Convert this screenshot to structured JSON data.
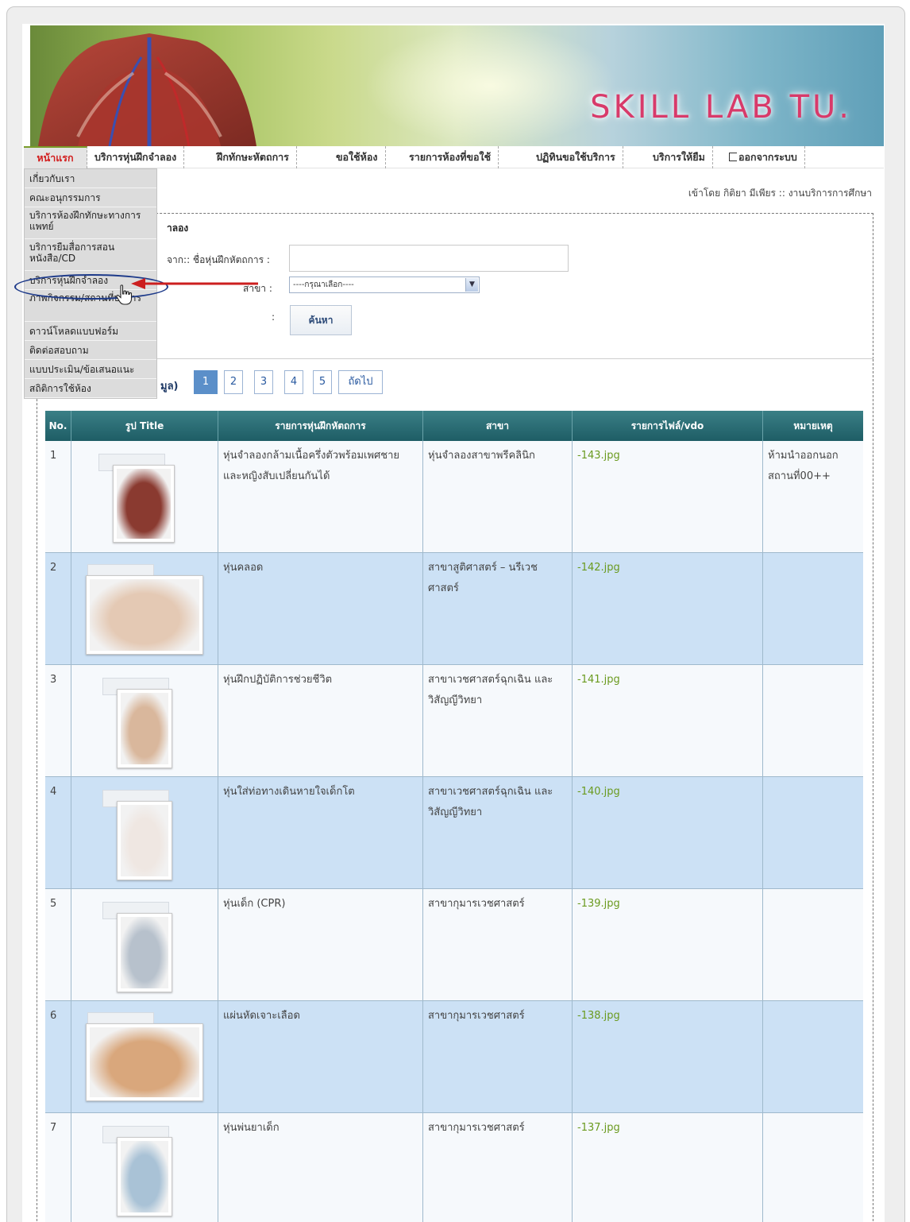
{
  "banner": {
    "logo_text": "SKILL LAB TU."
  },
  "nav": {
    "items": [
      {
        "label": "หน้าแรก"
      },
      {
        "label": "บริการหุ่นฝึกจำลอง"
      },
      {
        "label": "ฝึกทักษะหัตถการ"
      },
      {
        "label": "ขอใช้ห้อง"
      },
      {
        "label": "รายการห้องที่ขอใช้"
      },
      {
        "label": "ปฏิทินขอใช้บริการ"
      },
      {
        "label": "บริการให้ยืม"
      },
      {
        "label": "ออกจากระบบ"
      }
    ],
    "dropdown": [
      {
        "label": "เกี่ยวกับเรา"
      },
      {
        "label": "คณะอนุกรรมการ"
      },
      {
        "label": "บริการห้องฝึกทักษะทางการแพทย์"
      },
      {
        "label": "บริการยืมสื่อการสอน หนังสือ/CD"
      },
      {
        "label": "บริการหุ่นฝึกจำลอง"
      },
      {
        "label": "ภาพกิจกรรม/สถานที่บริการ"
      },
      {
        "label": "ดาวน์โหลดแบบฟอร์ม"
      },
      {
        "label": "ติดต่อสอบถาม"
      },
      {
        "label": "แบบประเมิน/ข้อเสนอแนะ"
      },
      {
        "label": "สถิติการใช้ห้อง"
      }
    ]
  },
  "user_line": "เข้าโดย กิติยา มีเพียร :: งานบริการการศึกษา",
  "search": {
    "title": "าลอง",
    "name_label": "จาก:: ชื่อหุ่นฝึกหัตถการ :",
    "name_value": "",
    "branch_label": "สาขา :",
    "branch_value": "----กรุณาเลือก----",
    "colon": ":",
    "button_label": "ค้นหา"
  },
  "result_count": "มูล)",
  "pager": {
    "pages": [
      "1",
      "2",
      "3",
      "4",
      "5"
    ],
    "next": "ถัดไป",
    "current": "1"
  },
  "table": {
    "headers": [
      "No.",
      "รูป Title",
      "รายการหุ่นฝึกหัตถการ",
      "สาขา",
      "รายการไฟล์/vdo",
      "หมายเหตุ"
    ],
    "rows": [
      {
        "no": "1",
        "name": "หุ่นจำลองกล้ามเนื้อครึ่งตัวพร้อมเพศชายและหญิงสับเปลี่ยนกันได้",
        "branch": "หุ่นจำลองสาขาพรีคลินิก",
        "file": "-143.jpg",
        "note": "ห้ามนำออกนอกสถานที่00++"
      },
      {
        "no": "2",
        "name": "หุ่นคลอด",
        "branch": "สาขาสูติศาสตร์ – นรีเวชศาสตร์",
        "file": "-142.jpg",
        "note": ""
      },
      {
        "no": "3",
        "name": "หุ่นฝึกปฏิบัติการช่วยชีวิต",
        "branch": "สาขาเวชศาสตร์ฉุกเฉิน และวิสัญญีวิทยา",
        "file": "-141.jpg",
        "note": ""
      },
      {
        "no": "4",
        "name": "หุ่นใส่ท่อทางเดินหายใจเด็กโต",
        "branch": "สาขาเวชศาสตร์ฉุกเฉิน และวิสัญญีวิทยา",
        "file": "-140.jpg",
        "note": ""
      },
      {
        "no": "5",
        "name": "หุ่นเด็ก (CPR)",
        "branch": "สาขากุมารเวชศาสตร์",
        "file": "-139.jpg",
        "note": ""
      },
      {
        "no": "6",
        "name": "แผ่นหัดเจาะเลือด",
        "branch": "สาขากุมารเวชศาสตร์",
        "file": "-138.jpg",
        "note": ""
      },
      {
        "no": "7",
        "name": "หุ่นพ่นยาเด็ก",
        "branch": "สาขากุมารเวชศาสตร์",
        "file": "-137.jpg",
        "note": ""
      }
    ]
  },
  "colors": {
    "nav_active": "#d21c1c",
    "header_bg": "#1e5d65",
    "row_alt": "#cce1f5",
    "file_link": "#6a9a1e",
    "highlight": "#1d3a8a",
    "arrow": "#cc1f1f"
  }
}
